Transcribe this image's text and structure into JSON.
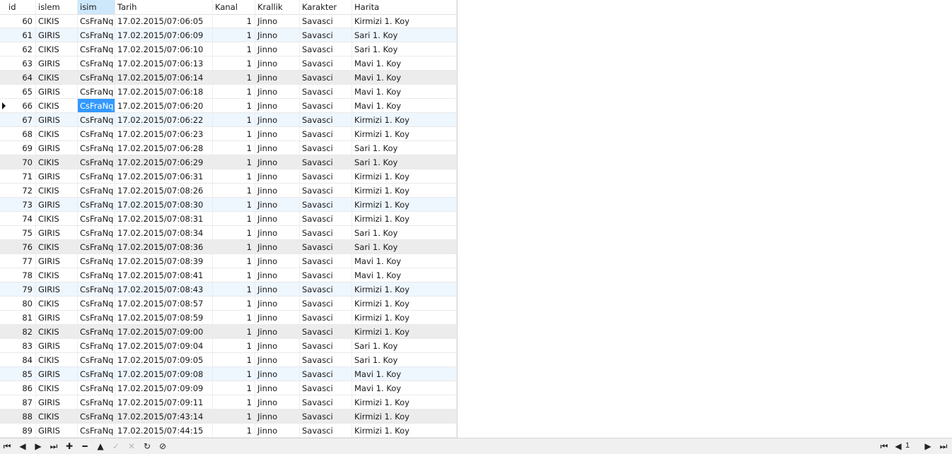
{
  "columns": [
    "id",
    "islem",
    "isim",
    "Tarih",
    "Kanal",
    "Krallik",
    "Karakter",
    "Harita"
  ],
  "sorted_column": "isim",
  "selected_row_index": 6,
  "rows": [
    [
      "60",
      "CIKIS",
      "CsFraNq",
      "17.02.2015/07:06:05",
      "1",
      "Jinno",
      "Savasci",
      "Kirmizi 1. Koy"
    ],
    [
      "61",
      "GIRIS",
      "CsFraNq",
      "17.02.2015/07:06:09",
      "1",
      "Jinno",
      "Savasci",
      "Sari 1. Koy"
    ],
    [
      "62",
      "CIKIS",
      "CsFraNq",
      "17.02.2015/07:06:10",
      "1",
      "Jinno",
      "Savasci",
      "Sari 1. Koy"
    ],
    [
      "63",
      "GIRIS",
      "CsFraNq",
      "17.02.2015/07:06:13",
      "1",
      "Jinno",
      "Savasci",
      "Mavi 1. Koy"
    ],
    [
      "64",
      "CIKIS",
      "CsFraNq",
      "17.02.2015/07:06:14",
      "1",
      "Jinno",
      "Savasci",
      "Mavi 1. Koy"
    ],
    [
      "65",
      "GIRIS",
      "CsFraNq",
      "17.02.2015/07:06:18",
      "1",
      "Jinno",
      "Savasci",
      "Mavi 1. Koy"
    ],
    [
      "66",
      "CIKIS",
      "CsFraNq",
      "17.02.2015/07:06:20",
      "1",
      "Jinno",
      "Savasci",
      "Mavi 1. Koy"
    ],
    [
      "67",
      "GIRIS",
      "CsFraNq",
      "17.02.2015/07:06:22",
      "1",
      "Jinno",
      "Savasci",
      "Kirmizi 1. Koy"
    ],
    [
      "68",
      "CIKIS",
      "CsFraNq",
      "17.02.2015/07:06:23",
      "1",
      "Jinno",
      "Savasci",
      "Kirmizi 1. Koy"
    ],
    [
      "69",
      "GIRIS",
      "CsFraNq",
      "17.02.2015/07:06:28",
      "1",
      "Jinno",
      "Savasci",
      "Sari 1. Koy"
    ],
    [
      "70",
      "CIKIS",
      "CsFraNq",
      "17.02.2015/07:06:29",
      "1",
      "Jinno",
      "Savasci",
      "Sari 1. Koy"
    ],
    [
      "71",
      "GIRIS",
      "CsFraNq",
      "17.02.2015/07:06:31",
      "1",
      "Jinno",
      "Savasci",
      "Kirmizi 1. Koy"
    ],
    [
      "72",
      "CIKIS",
      "CsFraNq",
      "17.02.2015/07:08:26",
      "1",
      "Jinno",
      "Savasci",
      "Kirmizi 1. Koy"
    ],
    [
      "73",
      "GIRIS",
      "CsFraNq",
      "17.02.2015/07:08:30",
      "1",
      "Jinno",
      "Savasci",
      "Kirmizi 1. Koy"
    ],
    [
      "74",
      "CIKIS",
      "CsFraNq",
      "17.02.2015/07:08:31",
      "1",
      "Jinno",
      "Savasci",
      "Kirmizi 1. Koy"
    ],
    [
      "75",
      "GIRIS",
      "CsFraNq",
      "17.02.2015/07:08:34",
      "1",
      "Jinno",
      "Savasci",
      "Sari 1. Koy"
    ],
    [
      "76",
      "CIKIS",
      "CsFraNq",
      "17.02.2015/07:08:36",
      "1",
      "Jinno",
      "Savasci",
      "Sari 1. Koy"
    ],
    [
      "77",
      "GIRIS",
      "CsFraNq",
      "17.02.2015/07:08:39",
      "1",
      "Jinno",
      "Savasci",
      "Mavi 1. Koy"
    ],
    [
      "78",
      "CIKIS",
      "CsFraNq",
      "17.02.2015/07:08:41",
      "1",
      "Jinno",
      "Savasci",
      "Mavi 1. Koy"
    ],
    [
      "79",
      "GIRIS",
      "CsFraNq",
      "17.02.2015/07:08:43",
      "1",
      "Jinno",
      "Savasci",
      "Kirmizi 1. Koy"
    ],
    [
      "80",
      "CIKIS",
      "CsFraNq",
      "17.02.2015/07:08:57",
      "1",
      "Jinno",
      "Savasci",
      "Kirmizi 1. Koy"
    ],
    [
      "81",
      "GIRIS",
      "CsFraNq",
      "17.02.2015/07:08:59",
      "1",
      "Jinno",
      "Savasci",
      "Kirmizi 1. Koy"
    ],
    [
      "82",
      "CIKIS",
      "CsFraNq",
      "17.02.2015/07:09:00",
      "1",
      "Jinno",
      "Savasci",
      "Kirmizi 1. Koy"
    ],
    [
      "83",
      "GIRIS",
      "CsFraNq",
      "17.02.2015/07:09:04",
      "1",
      "Jinno",
      "Savasci",
      "Sari 1. Koy"
    ],
    [
      "84",
      "CIKIS",
      "CsFraNq",
      "17.02.2015/07:09:05",
      "1",
      "Jinno",
      "Savasci",
      "Sari 1. Koy"
    ],
    [
      "85",
      "GIRIS",
      "CsFraNq",
      "17.02.2015/07:09:08",
      "1",
      "Jinno",
      "Savasci",
      "Mavi 1. Koy"
    ],
    [
      "86",
      "CIKIS",
      "CsFraNq",
      "17.02.2015/07:09:09",
      "1",
      "Jinno",
      "Savasci",
      "Mavi 1. Koy"
    ],
    [
      "87",
      "GIRIS",
      "CsFraNq",
      "17.02.2015/07:09:11",
      "1",
      "Jinno",
      "Savasci",
      "Kirmizi 1. Koy"
    ],
    [
      "88",
      "CIKIS",
      "CsFraNq",
      "17.02.2015/07:43:14",
      "1",
      "Jinno",
      "Savasci",
      "Kirmizi 1. Koy"
    ],
    [
      "89",
      "GIRIS",
      "CsFraNq",
      "17.02.2015/07:44:15",
      "1",
      "Jinno",
      "Savasci",
      "Kirmizi 1. Koy"
    ]
  ],
  "toolbar": {
    "buttons": [
      {
        "name": "first-record-icon",
        "glyph": "⏮",
        "enabled": true
      },
      {
        "name": "prev-record-icon",
        "glyph": "◀",
        "enabled": true
      },
      {
        "name": "next-record-icon",
        "glyph": "▶",
        "enabled": true
      },
      {
        "name": "last-record-icon",
        "glyph": "⏭",
        "enabled": true
      },
      {
        "name": "add-record-icon",
        "glyph": "✚",
        "enabled": true
      },
      {
        "name": "delete-record-icon",
        "glyph": "━",
        "enabled": true
      },
      {
        "name": "edit-record-icon",
        "glyph": "▲",
        "enabled": true
      },
      {
        "name": "apply-changes-icon",
        "glyph": "✓",
        "enabled": false
      },
      {
        "name": "discard-changes-icon",
        "glyph": "✕",
        "enabled": false
      },
      {
        "name": "refresh-icon",
        "glyph": "↻",
        "enabled": true
      },
      {
        "name": "stop-icon",
        "glyph": "⊘",
        "enabled": true
      }
    ]
  },
  "pager": {
    "page": "1"
  }
}
